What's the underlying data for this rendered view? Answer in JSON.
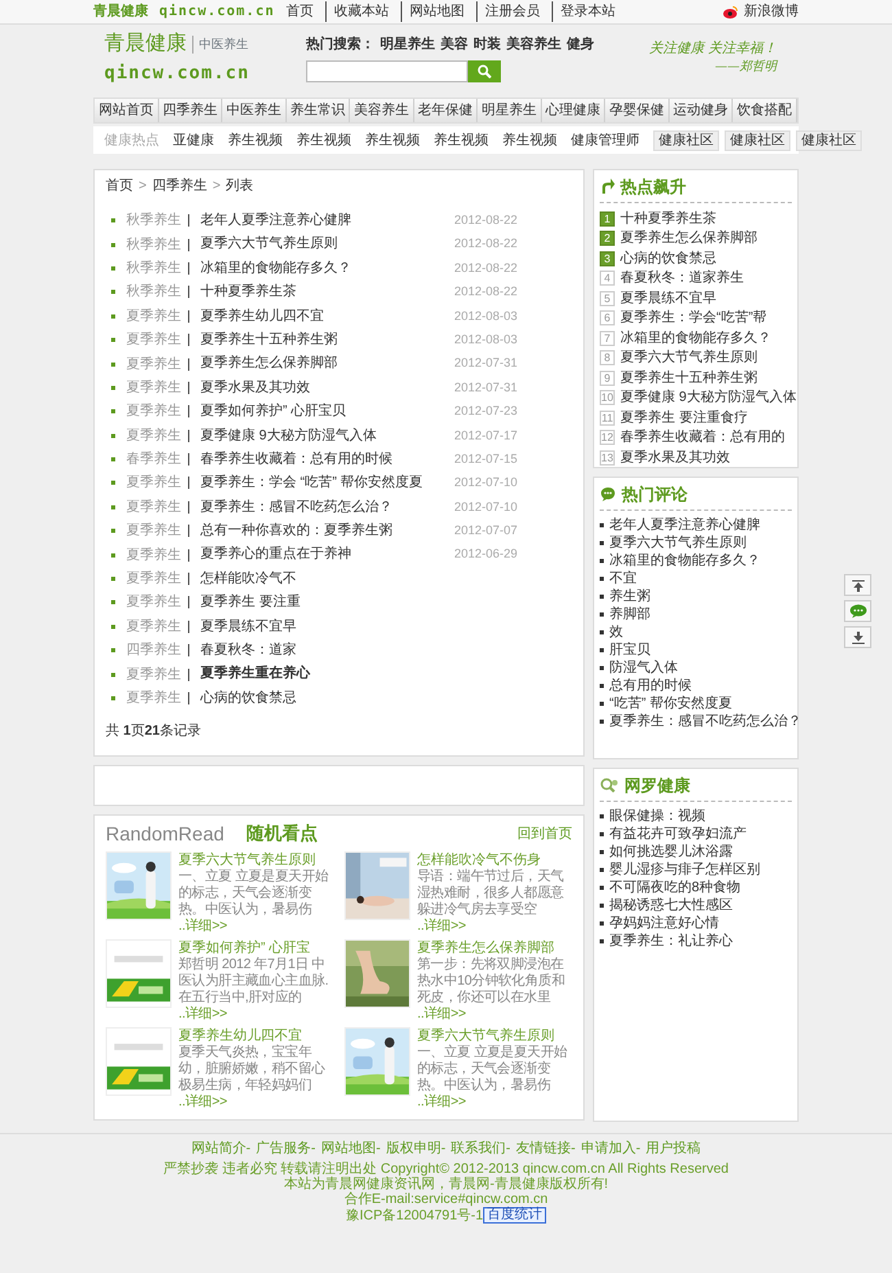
{
  "top_bar": {
    "logo_cn": "青晨健康",
    "logo_en": "qincw.com.cn",
    "links": [
      "首页",
      "收藏本站",
      "网站地图",
      "注册会员",
      "登录本站"
    ],
    "weibo": "新浪微博"
  },
  "header": {
    "logo_cn": "青晨健康",
    "tagline": "中医养生",
    "logo_en": "qincw.com.cn",
    "hot_search": {
      "label": "热门搜索：",
      "links": [
        "明星养生",
        "美容",
        "时装",
        "美容养生",
        "健身"
      ]
    },
    "slogan": "关注健康 关注幸福！",
    "signature": "——郑哲明"
  },
  "nav": [
    "网站首页",
    "四季养生",
    "中医养生",
    "养生常识",
    "美容养生",
    "老年保健",
    "明星养生",
    "心理健康",
    "孕婴保健",
    "运动健身",
    "饮食搭配"
  ],
  "subnav": {
    "label": "健康热点",
    "links": [
      "亚健康",
      "养生视频",
      "养生视频",
      "养生视频",
      "养生视频",
      "养生视频",
      "健康管理师"
    ],
    "community": [
      "健康社区",
      "健康社区",
      "健康社区"
    ]
  },
  "main": {
    "breadcrumb": {
      "items": [
        "首页",
        "四季养生",
        "列表"
      ],
      "separator": ">"
    },
    "articles": [
      {
        "category": "秋季养生",
        "title": "老年人夏季注意养心健脾",
        "date": "2012-08-22",
        "bold": false
      },
      {
        "category": "秋季养生",
        "title": "夏季六大节气养生原则",
        "date": "2012-08-22",
        "bold": false
      },
      {
        "category": "秋季养生",
        "title": "冰箱里的食物能存多久？",
        "date": "2012-08-22",
        "bold": false
      },
      {
        "category": "秋季养生",
        "title": "十种夏季养生茶",
        "date": "2012-08-22",
        "bold": false
      },
      {
        "category": "夏季养生",
        "title": "夏季养生幼儿四不宜",
        "date": "2012-08-03",
        "bold": false
      },
      {
        "category": "夏季养生",
        "title": "夏季养生十五种养生粥",
        "date": "2012-08-03",
        "bold": false
      },
      {
        "category": "夏季养生",
        "title": "夏季养生怎么保养脚部",
        "date": "2012-07-31",
        "bold": false
      },
      {
        "category": "夏季养生",
        "title": "夏季水果及其功效",
        "date": "2012-07-31",
        "bold": false
      },
      {
        "category": "夏季养生",
        "title": "夏季如何养护” 心肝宝贝",
        "date": "2012-07-23",
        "bold": false
      },
      {
        "category": "夏季养生",
        "title": "夏季健康 9大秘方防湿气入体",
        "date": "2012-07-17",
        "bold": false
      },
      {
        "category": "春季养生",
        "title": "春季养生收藏着：总有用的时候",
        "date": "2012-07-15",
        "bold": false
      },
      {
        "category": "夏季养生",
        "title": "夏季养生：学会 “吃苦” 帮你安然度夏",
        "date": "2012-07-10",
        "bold": false
      },
      {
        "category": "夏季养生",
        "title": "夏季养生：感冒不吃药怎么治？",
        "date": "2012-07-10",
        "bold": false
      },
      {
        "category": "夏季养生",
        "title": "总有一种你喜欢的：夏季养生粥",
        "date": "2012-07-07",
        "bold": false
      },
      {
        "category": "夏季养生",
        "title": "夏季养心的重点在于养神",
        "date": "2012-06-29",
        "bold": false
      },
      {
        "category": "夏季养生",
        "title": "怎样能吹冷气不",
        "bold": false
      },
      {
        "category": "夏季养生",
        "title": "夏季养生 要注重",
        "bold": false
      },
      {
        "category": "夏季养生",
        "title": "夏季晨练不宜早",
        "bold": false
      },
      {
        "category": "四季养生",
        "title": "春夏秋冬：道家",
        "bold": false
      },
      {
        "category": "夏季养生",
        "title": "夏季养生重在养心",
        "bold": true
      },
      {
        "category": "夏季养生",
        "title": "心病的饮食禁忌",
        "bold": false
      }
    ],
    "count": "共 **1**页**21**条记录"
  },
  "sidebar": {
    "hot": {
      "title": "热点飙升",
      "items": [
        {
          "rank": "1",
          "title": "十种夏季养生茶",
          "highlighted": true
        },
        {
          "rank": "2",
          "title": "夏季养生怎么保养脚部",
          "highlighted": true
        },
        {
          "rank": "3",
          "title": "心病的饮食禁忌",
          "highlighted": true
        },
        {
          "rank": "4",
          "title": "春夏秋冬：道家养生",
          "highlighted": false
        },
        {
          "rank": "5",
          "title": "夏季晨练不宜早",
          "highlighted": false
        },
        {
          "rank": "6",
          "title": "夏季养生：学会“吃苦”帮",
          "highlighted": false
        },
        {
          "rank": "7",
          "title": "冰箱里的食物能存多久？",
          "highlighted": false
        },
        {
          "rank": "8",
          "title": "夏季六大节气养生原则",
          "highlighted": false
        },
        {
          "rank": "9",
          "title": "夏季养生十五种养生粥",
          "highlighted": false
        },
        {
          "rank": "10",
          "title": "夏季健康 9大秘方防湿气入体",
          "highlighted": false
        },
        {
          "rank": "11",
          "title": "夏季养生 要注重食疗",
          "highlighted": false
        },
        {
          "rank": "12",
          "title": "春季养生收藏着：总有用的",
          "highlighted": false
        },
        {
          "rank": "13",
          "title": "夏季水果及其功效",
          "highlighted": false
        }
      ]
    },
    "comments": {
      "title": "热门评论",
      "items": [
        "老年人夏季注意养心健脾",
        "夏季六大节气养生原则",
        "冰箱里的食物能存多久？",
        "不宜",
        "养生粥",
        "养脚部",
        "效",
        "肝宝贝",
        "防湿气入体",
        "总有用的时候",
        "“吃苦” 帮你安然度夏",
        "夏季养生：感冒不吃药怎么治？"
      ]
    },
    "network": {
      "title": "网罗健康",
      "items": [
        "眼保健操：视频",
        "有益花卉可致孕妇流产",
        "如何挑选婴儿沐浴露",
        "婴儿湿疹与痱子怎样区别",
        "不可隔夜吃的8种食物",
        "揭秘诱惑七大性感区",
        "孕妈妈注意好心情",
        "夏季养生：礼让养心"
      ]
    }
  },
  "random": {
    "title_en": "RandomRead",
    "title_cn": "随机看点",
    "home_link": "回到首页",
    "columns": [
      [
        {
          "title": "夏季六大节气养生原则",
          "summary": "一、立夏 立夏是夏天开始的标志，天气会逐渐变热。中医认为，暑易伤",
          "more": "..详细>>"
        },
        {
          "title": "夏季如何养护” 心肝宝",
          "summary": "郑哲明 2012 年7月1日 中医认为肝主藏血心主血脉.在五行当中,肝对应的",
          "more": "..详细>>"
        },
        {
          "title": "夏季养生幼儿四不宜",
          "summary": "夏季天气炎热，宝宝年幼，脏腑娇嫩，稍不留心极易生病，年轻妈妈们",
          "more": "..详细>>"
        }
      ],
      [
        {
          "title": "怎样能吹冷气不伤身",
          "summary": "导语：端午节过后，天气湿热难耐，很多人都愿意躲进冷气房去享受空",
          "more": "..详细>>"
        },
        {
          "title": "夏季养生怎么保养脚部",
          "summary": "第一步：先将双脚浸泡在热水中10分钟软化角质和死皮，你还可以在水里",
          "more": "..详细>>"
        },
        {
          "title": "夏季六大节气养生原则",
          "summary": "一、立夏 立夏是夏天开始的标志，天气会逐渐变热。中医认为，暑易伤",
          "more": "..详细>>"
        }
      ]
    ]
  },
  "footer": {
    "links": [
      "网站简介-",
      "广告服务-",
      "网站地图-",
      "版权申明-",
      "联系我们-",
      "友情链接-",
      "申请加入-",
      "用户投稿"
    ],
    "lines": [
      "严禁抄袭 违者必究 转载请注明出处 Copyright© 2012-2013 qincw.com.cn All Rights Reserved",
      "本站为青晨网健康资讯网，青晨网-青晨健康版权所有!",
      "合作E-mail:service#qincw.com.cn"
    ],
    "icp": "豫ICP备12004791号-1",
    "stat_badge": "百度统计"
  }
}
